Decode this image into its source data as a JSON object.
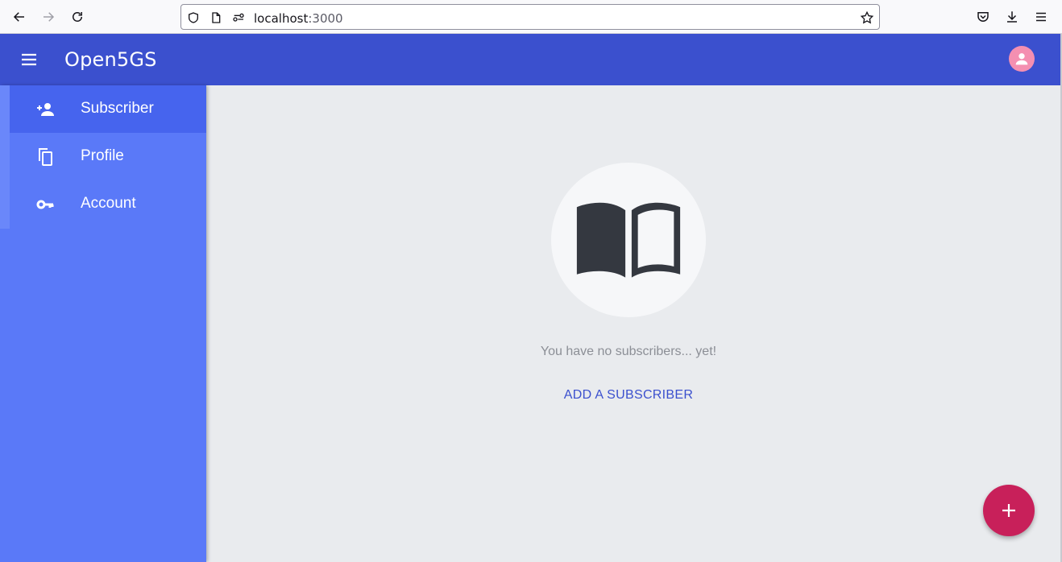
{
  "browser": {
    "url_host": "localhost",
    "url_port": ":3000",
    "icons": [
      "back-arrow-icon",
      "forward-arrow-icon",
      "reload-icon",
      "shield-icon",
      "page-icon",
      "permissions-icon",
      "bookmark-star-icon",
      "pocket-icon",
      "download-icon",
      "hamburger-menu-icon"
    ]
  },
  "header": {
    "title": "Open5GS",
    "color": "#3b50ce",
    "icons": [
      "menu-icon",
      "account-circle-icon"
    ]
  },
  "sidebar": {
    "color": "#5a79f8",
    "items": [
      {
        "label": "Subscriber",
        "icon": "person-add-icon",
        "active": true
      },
      {
        "label": "Profile",
        "icon": "copy-icon",
        "active": false
      },
      {
        "label": "Account",
        "icon": "key-icon",
        "active": false
      }
    ]
  },
  "main": {
    "empty_icon": "book-open-icon",
    "empty_message": "You have no subscribers... yet!",
    "add_label": "ADD A SUBSCRIBER",
    "fab_icon": "plus-icon",
    "fab_color": "#c8205a"
  }
}
